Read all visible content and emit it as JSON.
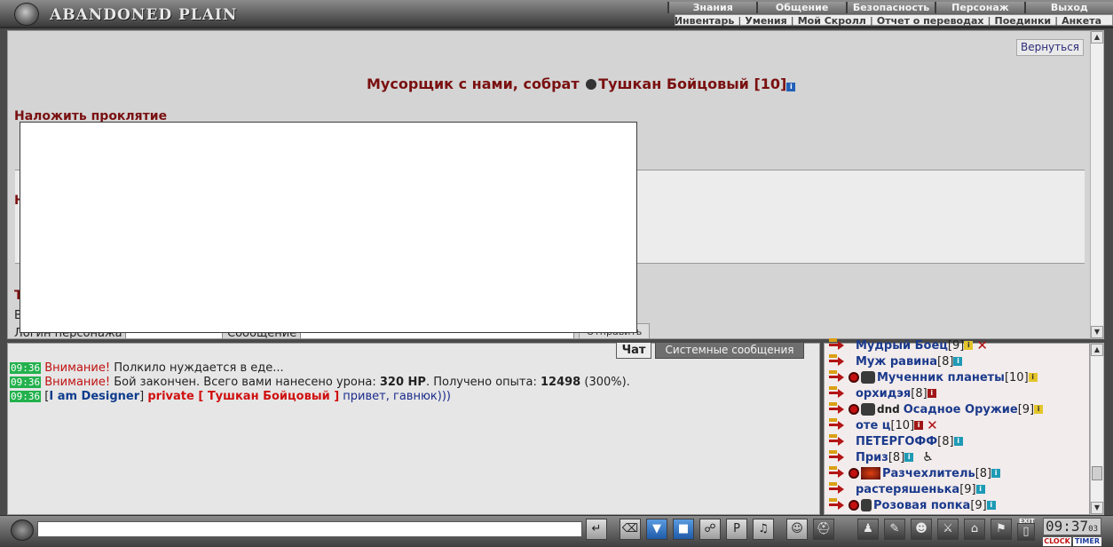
{
  "header": {
    "logo_text": "ABANDONED PLAIN",
    "menu": [
      "Знания",
      "Общение",
      "Безопасность",
      "Персонаж",
      "Выход"
    ],
    "submenu": [
      "Инвентарь",
      "Умения",
      "Мой Скролл",
      "Отчет о переводах",
      "Поединки",
      "Анкета"
    ]
  },
  "main": {
    "back_label": "Вернуться",
    "title_prefix": "Мусорщик с нами, собрат",
    "title_name": "Тушкан Бойцовый",
    "title_level": "[10]",
    "curse_heading": "Наложить проклятие",
    "cut_heading_1": "Н",
    "cut_heading_2": "Т",
    "cut_text": "В",
    "login_label": "Логин персонажа",
    "message_label": "Сообщение",
    "send_label": "Отправить"
  },
  "chat": {
    "tabs": [
      "Чат",
      "Системные сообщения"
    ],
    "lines": [
      {
        "time": "09:36",
        "warn": "Внимание!",
        "text": "Полкило нуждается в еде..."
      },
      {
        "time": "09:36",
        "warn": "Внимание!",
        "text_a": "Бой закончен. Всего вами нанесено урона:",
        "dmg": "320 HP",
        "text_b": ". Получено опыта:",
        "exp": "12498",
        "text_c": "(300%)."
      },
      {
        "time": "09:36",
        "user": "I am Designer",
        "private_label": "private [ Тушкан Бойцовый ]",
        "msg": "привет, гавнюк)))"
      }
    ]
  },
  "online": {
    "rows": [
      {
        "name": "Мудрый Боец",
        "level": "[9]"
      },
      {
        "name": "Муж равина",
        "level": "[8]"
      },
      {
        "name": "Мученник планеты",
        "level": "[10]"
      },
      {
        "name": "орхидэя",
        "level": "[8]"
      },
      {
        "dnd": "dnd",
        "name": "Осадное Оружие",
        "level": "[9]"
      },
      {
        "name": "оте ц",
        "level": "[10]"
      },
      {
        "name": "ПЕТЕРГОФФ",
        "level": "[8]"
      },
      {
        "name": "Приз",
        "level": "[8]"
      },
      {
        "name": "Разчехлитель",
        "level": "[8]"
      },
      {
        "name": "растеряшенька",
        "level": "[9]"
      },
      {
        "name": "Розовая попка",
        "level": "[9]"
      }
    ]
  },
  "toolbar": {
    "exit_label": "EXIT",
    "clock_time": "09:37",
    "clock_seconds": "03",
    "clock_label": "CLOCK",
    "timer_label": "TIMER"
  },
  "colors": {
    "accent_red": "#7a1010",
    "link_blue": "#1b3a8c",
    "time_green": "#22b14c"
  }
}
